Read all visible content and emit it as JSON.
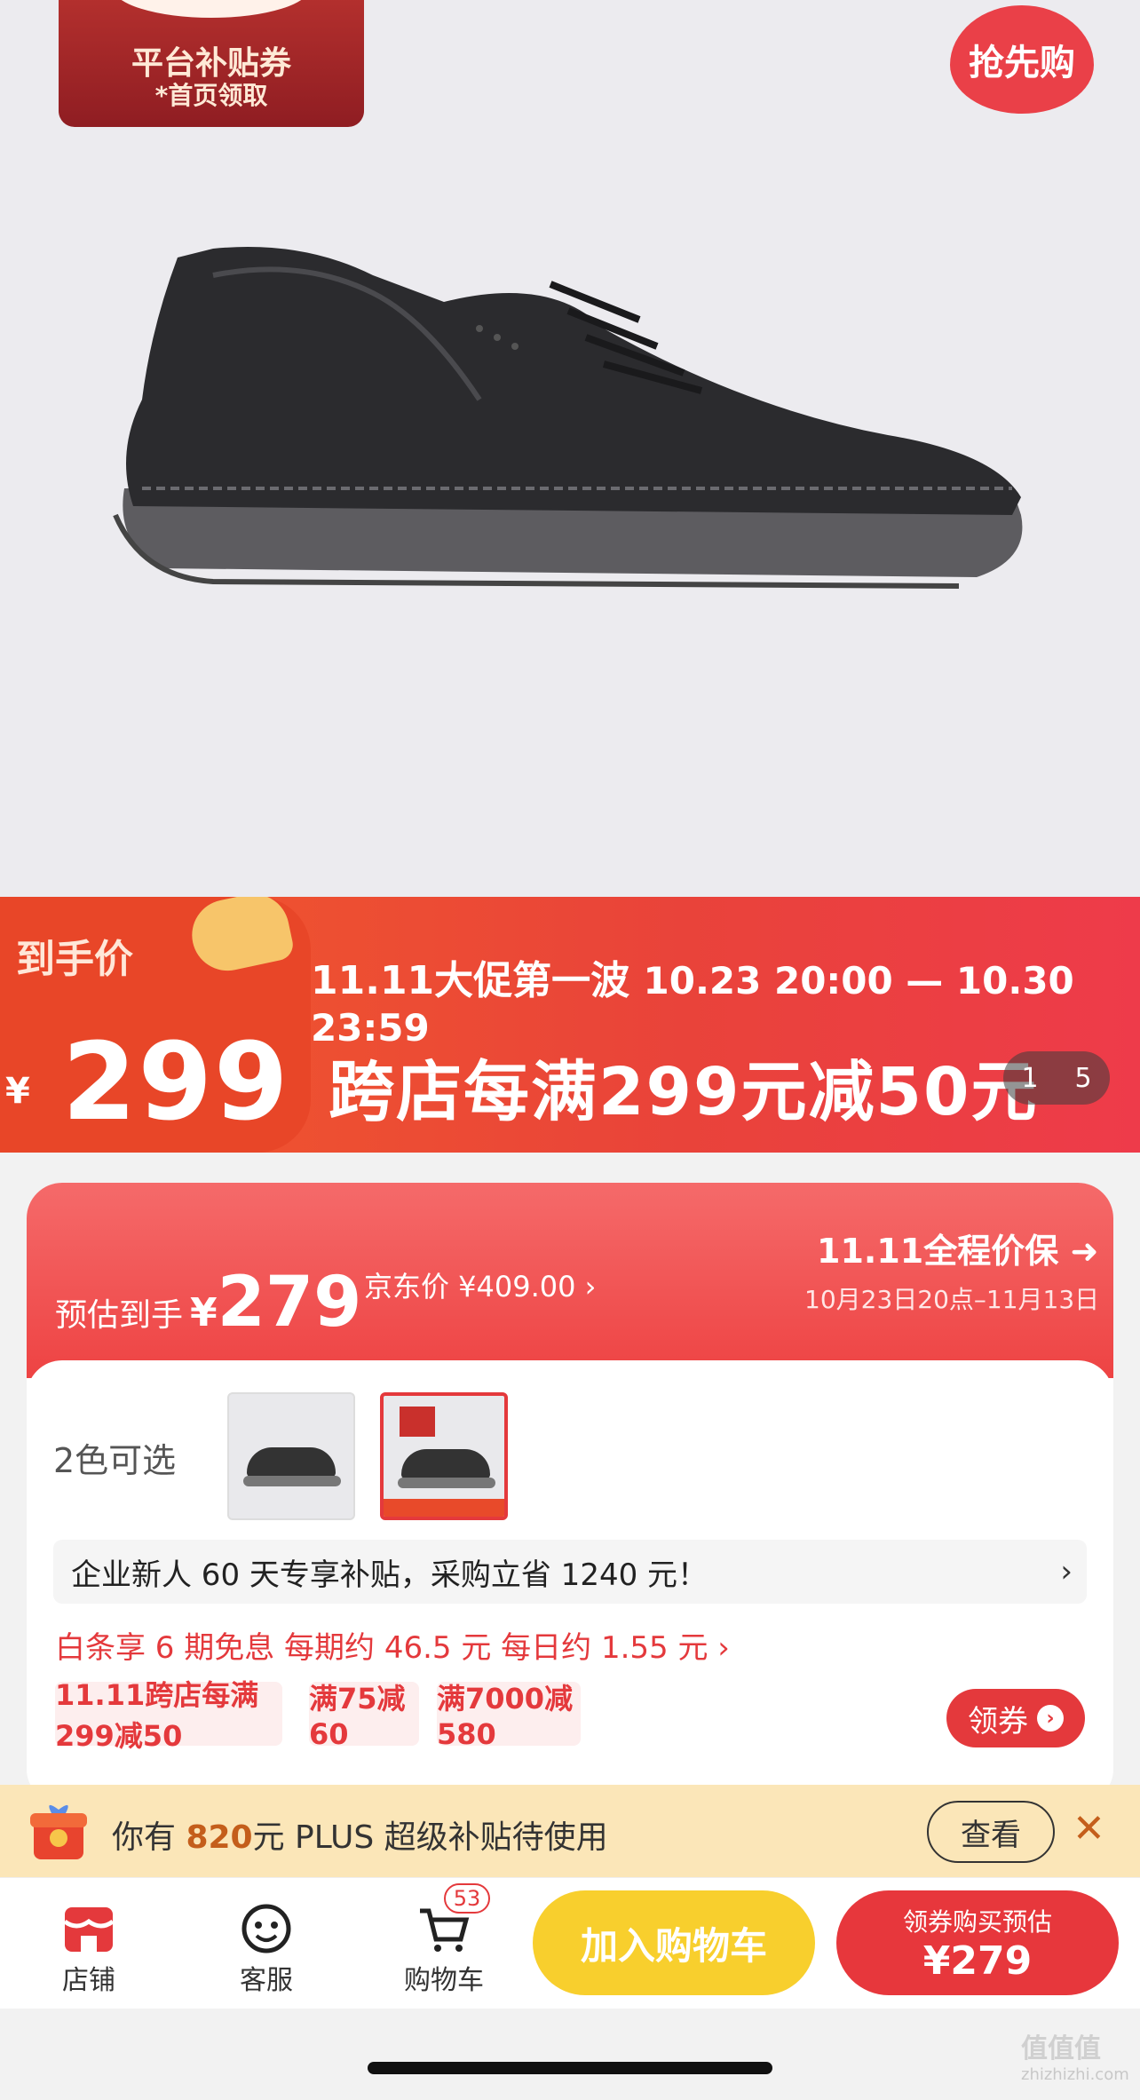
{
  "hero": {
    "coupon_line1": "平台补贴券",
    "coupon_line2": "*首页领取",
    "rush_button": "抢先购"
  },
  "banner": {
    "label": "到手价",
    "currency": "¥",
    "price": "299",
    "promo_title": "11.11大促第一波",
    "promo_dates": "10.23 20:00 — 10.30 23:59",
    "promo_main": "跨店每满299元减50元",
    "pager_current": "1",
    "pager_total": "5"
  },
  "price_card": {
    "estimate_label": "预估到手",
    "estimate_currency": "¥",
    "estimate_value": "279",
    "jd_price": "京东价 ¥409.00 ›",
    "protect_title": "11.11全程价保",
    "protect_period": "10月23日20点–11月13日",
    "colors_label": "2色可选",
    "business_offer": "企业新人 60 天专享补贴，采购立省 1240 元！",
    "business_arrow": "›",
    "baitiao": "白条享 6 期免息  每期约 46.5 元  每日约 1.55 元 ›",
    "chips": [
      "11.11跨店每满299减50",
      "满75减60",
      "满7000减580"
    ],
    "get_coupon": "领券",
    "accent": "#e4393c"
  },
  "plus_bar": {
    "text_prefix": "你有 ",
    "amount": "820",
    "text_suffix": "元 PLUS 超级补贴待使用",
    "view": "查看",
    "close": "✕"
  },
  "bottom_bar": {
    "store": "店铺",
    "service": "客服",
    "cart": "购物车",
    "cart_count": "53",
    "add_to_cart": "加入购物车",
    "buy_line1": "领券购买预估",
    "buy_line2": "¥279"
  },
  "watermark": {
    "main": "值值值",
    "sub": "zhizhizhi.com"
  }
}
